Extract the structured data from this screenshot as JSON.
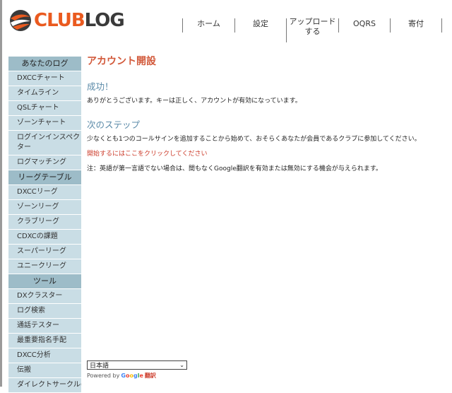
{
  "logo": {
    "club": "CLUB",
    "log": "LOG"
  },
  "nav": {
    "home": "ホーム",
    "settings": "設定",
    "upload_line1": "アップロード",
    "upload_line2": "する",
    "oqrs": "OQRS",
    "donate": "寄付"
  },
  "sidebar": {
    "sections": [
      {
        "header": "あなたのログ",
        "items": [
          "DXCCチャート",
          "タイムライン",
          "QSLチャート",
          "ゾーンチャート",
          "ログインインスペクター",
          "ログマッチング"
        ]
      },
      {
        "header": "リーグテーブル",
        "items": [
          "DXCCリーグ",
          "ゾーンリーグ",
          "クラブリーグ",
          "CDXCの課題",
          "スーパーリーグ",
          "ユニークリーグ"
        ]
      },
      {
        "header": "ツール",
        "items": [
          "DXクラスター",
          "ログ検索",
          "通話テスター",
          "最重要指名手配",
          "DXCC分析",
          "伝搬",
          "ダイレクトサークルの旅"
        ]
      }
    ]
  },
  "main": {
    "title": "アカウント開設",
    "success_heading": "成功！",
    "success_text": "ありがとうございます。キーは正しく、アカウントが有効になっています。",
    "next_heading": "次のステップ",
    "next_text": "少なくとも1つのコールサインを追加することから始めて、おそらくあなたが会員であるクラブに参加してください。",
    "start_link": "開始するにはここをクリックしてください",
    "note": "注：英語が第一言語でない場合は、間もなくGoogle翻訳を有効または無効にする機会が与えられます。"
  },
  "translate": {
    "selected_language": "日本語",
    "powered_by": "Powered by",
    "google": "Google",
    "translate_word": "翻訳"
  },
  "colors": {
    "accent_orange": "#ea5a1f",
    "title_red": "#d2593a",
    "heading_blue": "#5a8aa8",
    "sidebar_header": "#9dbcc8",
    "sidebar_item": "#c9dde5"
  }
}
